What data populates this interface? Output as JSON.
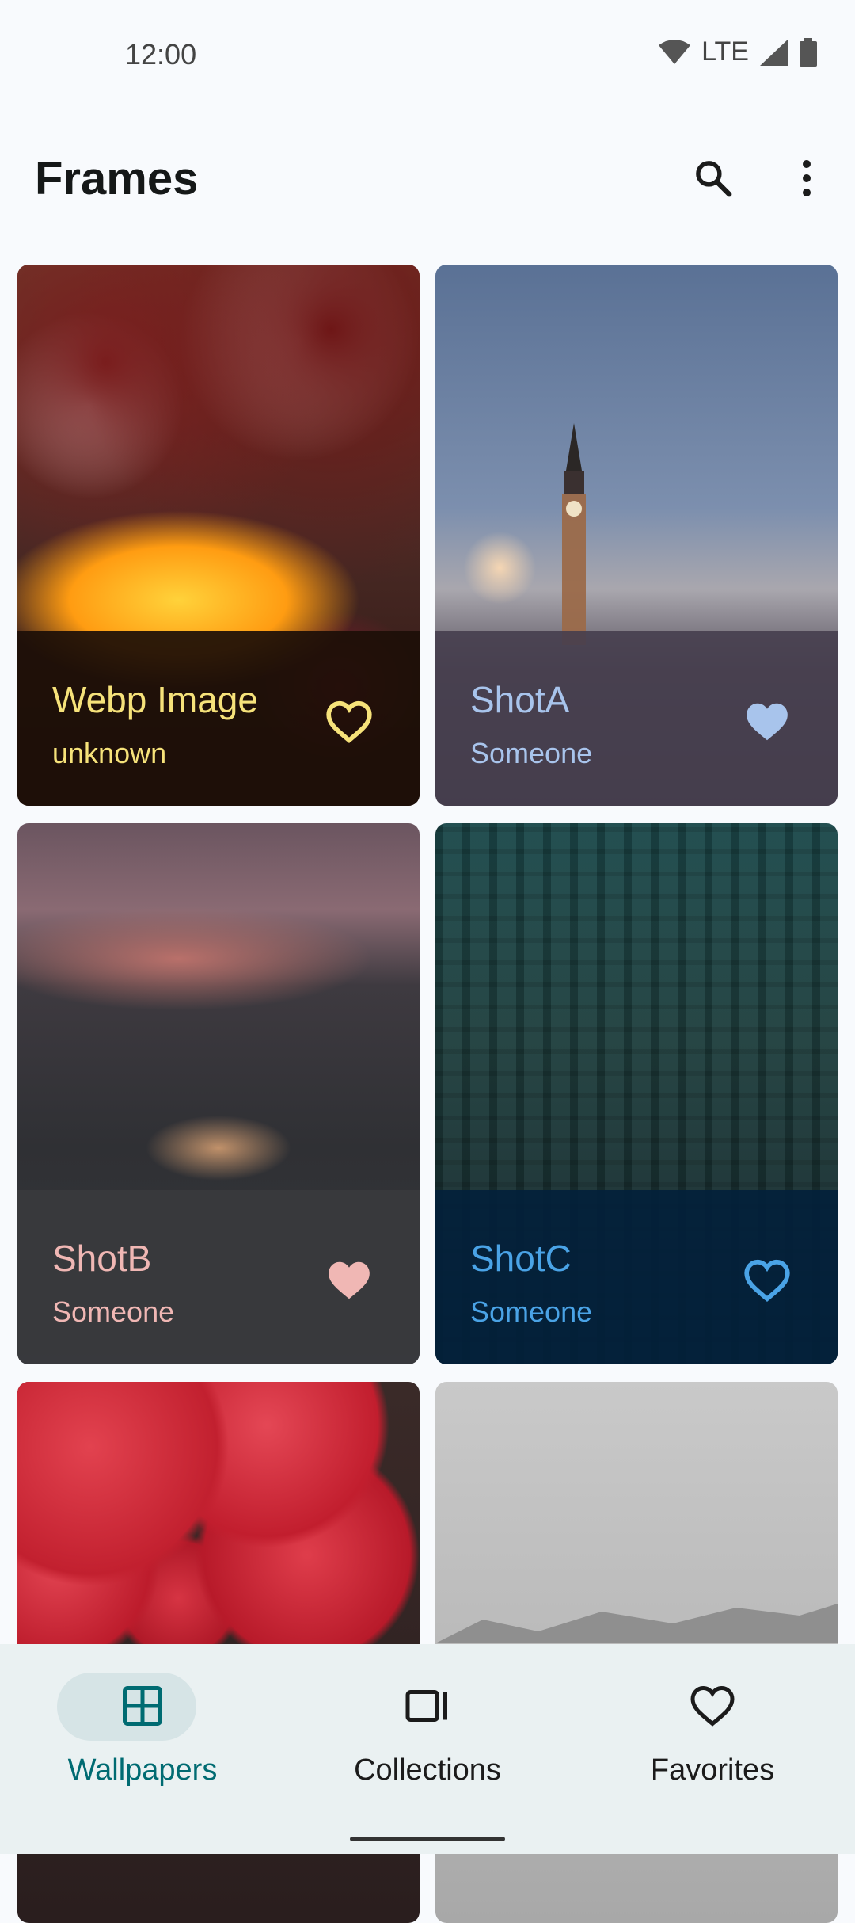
{
  "status_bar": {
    "time": "12:00",
    "network": "LTE"
  },
  "app_bar": {
    "title": "Frames",
    "search_icon": "search-icon",
    "more_icon": "more-vert-icon"
  },
  "wallpapers": [
    {
      "title": "Webp Image",
      "author": "unknown",
      "favorited": false,
      "text_color": "#f6e27a",
      "overlay_color": "#1d0f07"
    },
    {
      "title": "ShotA",
      "author": "Someone",
      "favorited": true,
      "text_color": "#a8c4ec",
      "overlay_color": "#463e4e"
    },
    {
      "title": "ShotB",
      "author": "Someone",
      "favorited": true,
      "text_color": "#f0b7b4",
      "overlay_color": "#38393d"
    },
    {
      "title": "ShotC",
      "author": "Someone",
      "favorited": false,
      "text_color": "#4aa3e6",
      "overlay_color": "#03203a"
    },
    {
      "title": "",
      "author": "",
      "favorited": false,
      "text_color": "#ffffff",
      "overlay_color": "#000000"
    },
    {
      "title": "",
      "author": "",
      "favorited": false,
      "text_color": "#ffffff",
      "overlay_color": "#000000"
    }
  ],
  "bottom_nav": {
    "items": [
      {
        "label": "Wallpapers",
        "icon": "grid-icon",
        "selected": true
      },
      {
        "label": "Collections",
        "icon": "collections-icon",
        "selected": false
      },
      {
        "label": "Favorites",
        "icon": "heart-icon",
        "selected": false
      }
    ],
    "accent_color": "#006b72",
    "pill_color": "#d6e4e6"
  }
}
